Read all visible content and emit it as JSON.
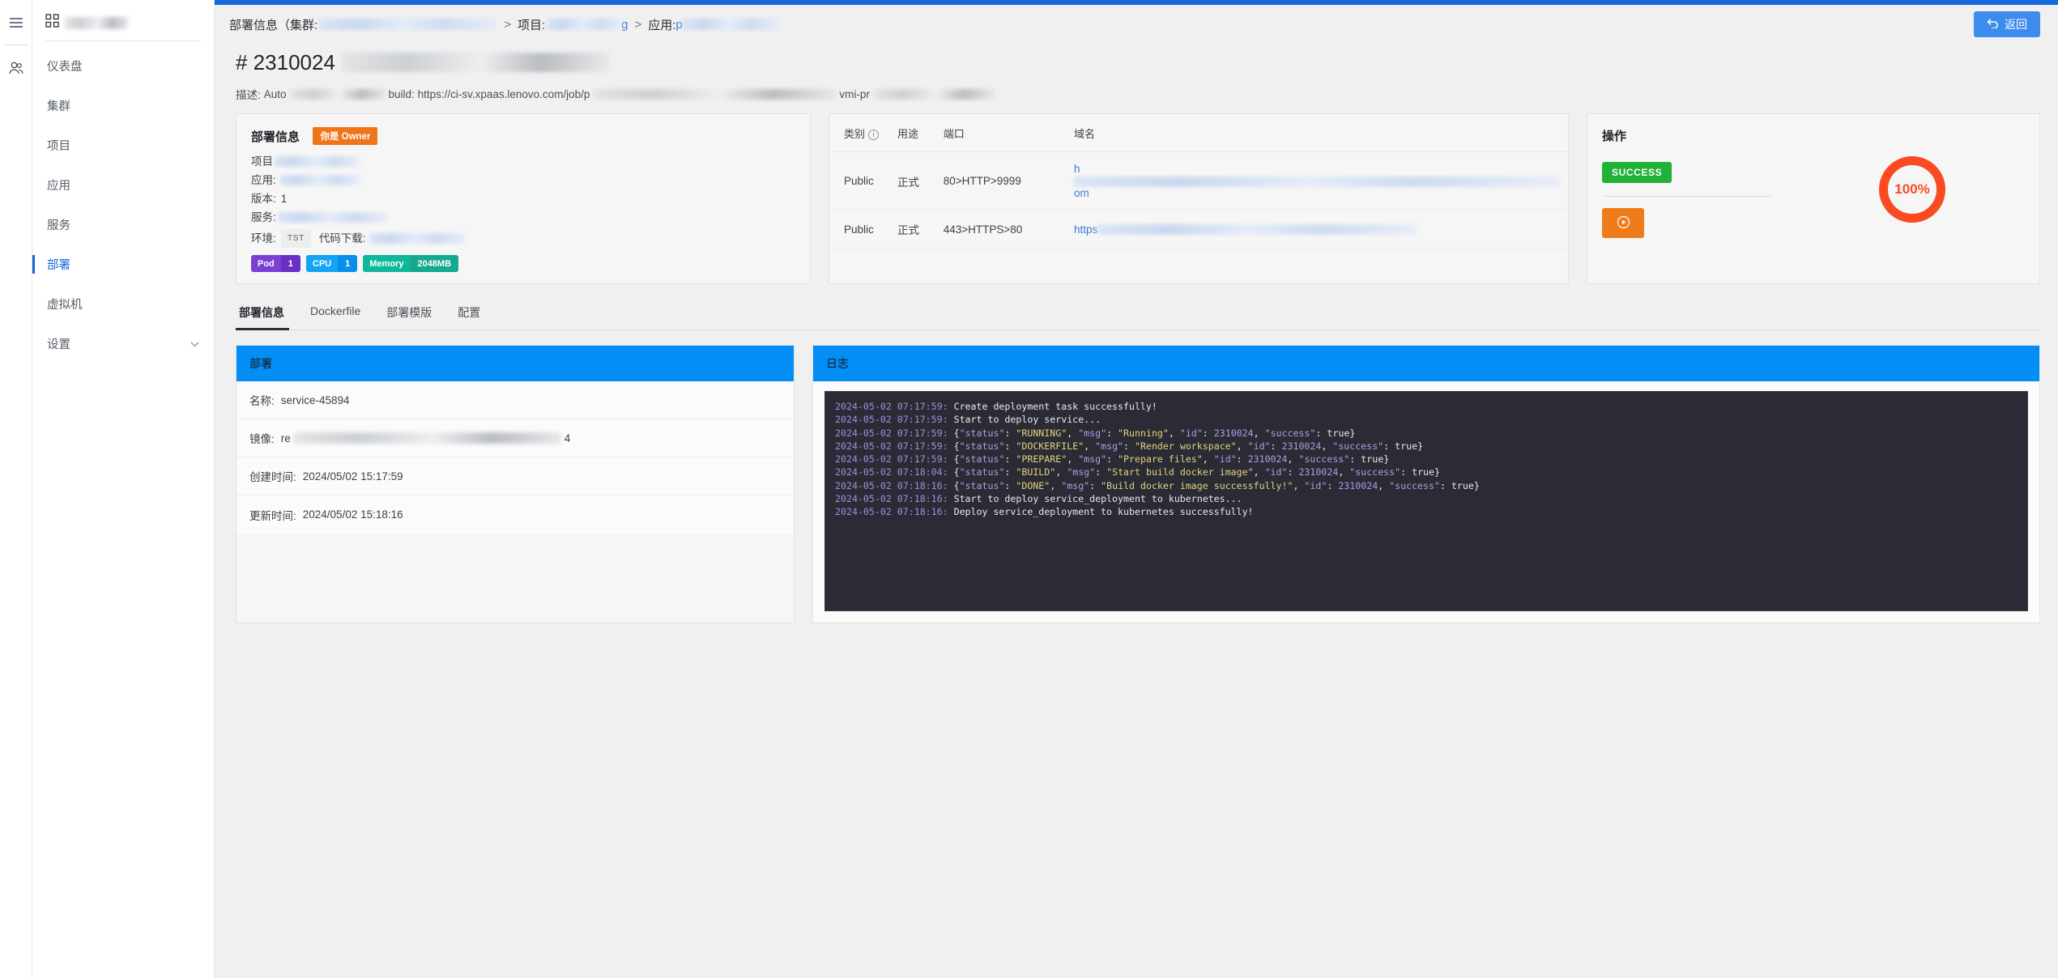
{
  "rail": {
    "menu_icon": "hamburger-menu-icon",
    "users_icon": "users-icon"
  },
  "sidebar": {
    "logo_icon": "apps-grid-icon",
    "items": [
      {
        "label": "仪表盘",
        "active": false
      },
      {
        "label": "集群",
        "active": false
      },
      {
        "label": "项目",
        "active": false
      },
      {
        "label": "应用",
        "active": false
      },
      {
        "label": "服务",
        "active": false
      },
      {
        "label": "部署",
        "active": true
      },
      {
        "label": "虚拟机",
        "active": false
      },
      {
        "label": "设置",
        "active": false,
        "chevron": "chevron-down-icon"
      }
    ]
  },
  "breadcrumb": {
    "title": "部署信息",
    "open_paren": "（",
    "cluster_label": "集群:",
    "sep": ">",
    "project_label": "项目:",
    "project_suffix": "g",
    "app_label": "应用:",
    "app_prefix": "p"
  },
  "back_button": {
    "label": "返回",
    "icon": "undo-arrow-icon"
  },
  "page": {
    "id": "# 2310024",
    "desc_label": "描述:",
    "desc_text": "Auto",
    "desc_mid": "build: https://ci-sv.xpaas.lenovo.com/job/p",
    "desc_tail": "vmi-pr"
  },
  "deploy_info": {
    "title": "部署信息",
    "owner_badge": "你是 Owner",
    "project_label": "项目",
    "app_label": "应用:",
    "version_label": "版本:",
    "version_value": "1",
    "service_label": "服务:",
    "env_label": "环境:",
    "env_value": "TST",
    "code_label": "代码下载:",
    "badges": [
      {
        "key": "Pod",
        "value": "1",
        "key_color": "#7b3fd4",
        "value_color": "#6a2fc4"
      },
      {
        "key": "CPU",
        "value": "1",
        "key_color": "#14a3f5",
        "value_color": "#0a8fe8"
      },
      {
        "key": "Memory",
        "value": "2048MB",
        "key_color": "#0fb89b",
        "value_color": "#16a98f"
      }
    ]
  },
  "ports": {
    "columns": [
      "类别",
      "用途",
      "端口",
      "域名"
    ],
    "type_info_icon": "info-circle-icon",
    "rows": [
      {
        "type": "Public",
        "use": "正式",
        "port": "80>HTTP>9999",
        "domain_prefix": "h",
        "domain_suffix": "om"
      },
      {
        "type": "Public",
        "use": "正式",
        "port": "443>HTTPS>80",
        "domain_prefix": "https",
        "domain_suffix": ""
      }
    ]
  },
  "operations": {
    "title": "操作",
    "status": "SUCCESS",
    "status_color": "#22b137",
    "play_icon": "play-circle-icon",
    "play_color": "#ef7c1b",
    "progress": "100%",
    "progress_color": "#fa4a22"
  },
  "tabs": [
    {
      "label": "部署信息",
      "active": true
    },
    {
      "label": "Dockerfile",
      "active": false
    },
    {
      "label": "部署模版",
      "active": false
    },
    {
      "label": "配置",
      "active": false
    }
  ],
  "deploy_panel": {
    "title": "部署",
    "rows": [
      {
        "label": "名称:",
        "value": "service-45894",
        "blurred": false
      },
      {
        "label": "镜像:",
        "value": "re",
        "value_tail": "4",
        "blurred": true
      },
      {
        "label": "创建时间:",
        "value": "2024/05/02 15:17:59",
        "blurred": false
      },
      {
        "label": "更新时间:",
        "value": "2024/05/02 15:18:16",
        "blurred": false
      }
    ]
  },
  "log_panel": {
    "title": "日志",
    "lines": [
      {
        "ts": "2024-05-02 07:17:59: ",
        "plain": "Create deployment task successfully!"
      },
      {
        "ts": "2024-05-02 07:17:59: ",
        "plain": "Start to deploy service..."
      },
      {
        "ts": "2024-05-02 07:17:59: ",
        "json": {
          "status": "RUNNING",
          "msg": "Running",
          "id": "2310024",
          "success": "true"
        }
      },
      {
        "ts": "2024-05-02 07:17:59: ",
        "json": {
          "status": "DOCKERFILE",
          "msg": "Render workspace",
          "id": "2310024",
          "success": "true"
        }
      },
      {
        "ts": "2024-05-02 07:17:59: ",
        "json": {
          "status": "PREPARE",
          "msg": "Prepare files",
          "id": "2310024",
          "success": "true"
        }
      },
      {
        "ts": "2024-05-02 07:18:04: ",
        "json": {
          "status": "BUILD",
          "msg": "Start build docker image",
          "id": "2310024",
          "success": "true"
        }
      },
      {
        "ts": "2024-05-02 07:18:16: ",
        "json": {
          "status": "DONE",
          "msg": "Build docker image successfully!",
          "id": "2310024",
          "success": "true"
        }
      },
      {
        "ts": "2024-05-02 07:18:16: ",
        "plain": "Start to deploy service_deployment to kubernetes..."
      },
      {
        "ts": "2024-05-02 07:18:16: ",
        "plain": "Deploy service_deployment to kubernetes successfully!"
      }
    ]
  }
}
